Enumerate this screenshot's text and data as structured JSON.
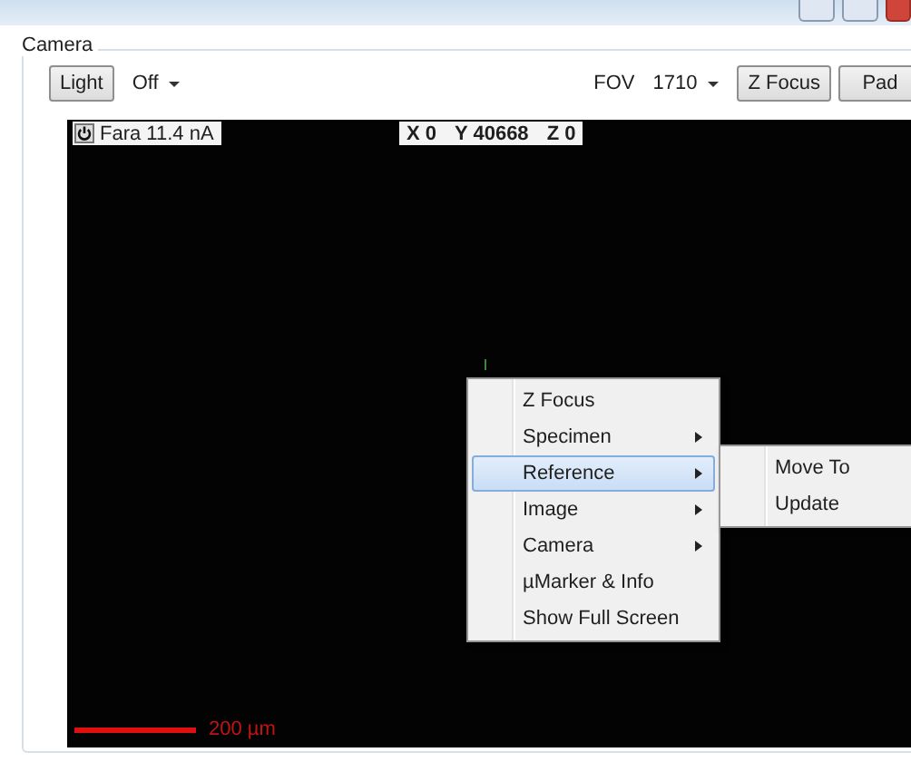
{
  "camera": {
    "title": "Camera",
    "light_button": "Light",
    "light_mode": "Off",
    "fov_label": "FOV",
    "fov_value": "1710",
    "z_focus_button": "Z Focus",
    "pad_button": "Pad"
  },
  "viewport": {
    "status": "Fara 11.4 nA",
    "coords": [
      "X 0",
      "Y 40668",
      "Z 0"
    ],
    "scale": "200 µm"
  },
  "context_menu": [
    {
      "label": "Z Focus",
      "has_submenu": false,
      "selected": false
    },
    {
      "label": "Specimen",
      "has_submenu": true,
      "selected": false
    },
    {
      "label": "Reference",
      "has_submenu": true,
      "selected": true
    },
    {
      "label": "Image",
      "has_submenu": true,
      "selected": false
    },
    {
      "label": "Camera",
      "has_submenu": true,
      "selected": false
    },
    {
      "label": "µMarker & Info",
      "has_submenu": false,
      "selected": false
    },
    {
      "label": "Show Full Screen",
      "has_submenu": false,
      "selected": false
    }
  ],
  "submenu": [
    {
      "label": "Move To"
    },
    {
      "label": "Update"
    }
  ]
}
